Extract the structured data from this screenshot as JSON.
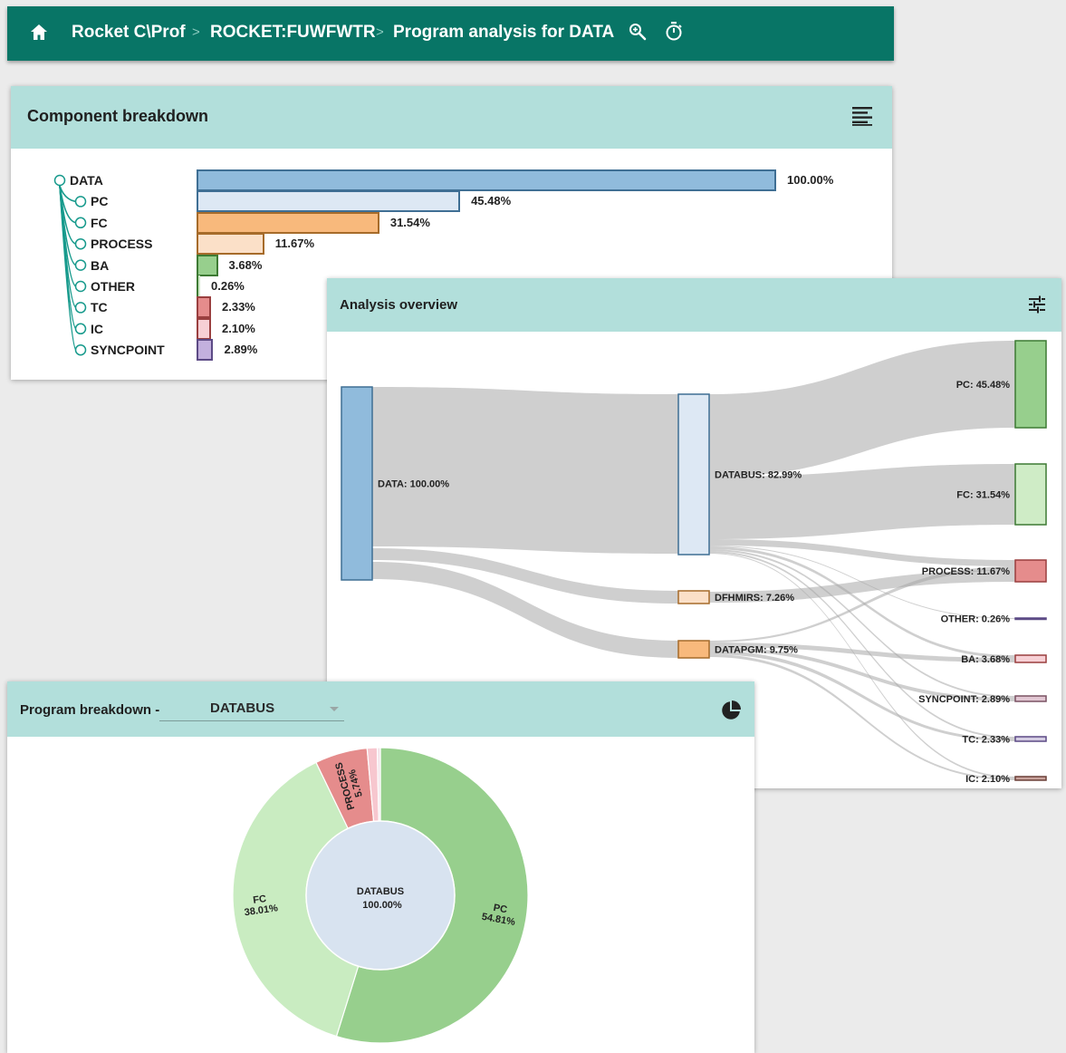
{
  "breadcrumb": {
    "items": [
      "Rocket C\\Prof",
      "ROCKET:FUWFWTR",
      "Program analysis for DATA"
    ],
    "separator": ">"
  },
  "icons": {
    "home": "home-icon",
    "search": "search-zoom-icon",
    "timer": "stopwatch-icon",
    "list": "align-list-icon",
    "tune": "tune-sliders-icon",
    "pie": "pie-chart-icon"
  },
  "colors": {
    "topbar": "#087566",
    "panel_header": "#b2dfdb",
    "tree_line": "#179a8c"
  },
  "component_breakdown": {
    "title": "Component breakdown",
    "rows": [
      {
        "name": "DATA",
        "value": "100.00%",
        "pct": 100.0,
        "fill": "#90bbdc",
        "stroke": "#3f6f94",
        "level": 0
      },
      {
        "name": "PC",
        "value": "45.48%",
        "pct": 45.48,
        "fill": "#dde8f4",
        "stroke": "#3f6f94",
        "level": 1
      },
      {
        "name": "FC",
        "value": "31.54%",
        "pct": 31.54,
        "fill": "#f8b97c",
        "stroke": "#a66b2a",
        "level": 1
      },
      {
        "name": "PROCESS",
        "value": "11.67%",
        "pct": 11.67,
        "fill": "#fbe0c8",
        "stroke": "#a66b2a",
        "level": 1
      },
      {
        "name": "BA",
        "value": "3.68%",
        "pct": 3.68,
        "fill": "#97cf8d",
        "stroke": "#3d7a33",
        "level": 1
      },
      {
        "name": "OTHER",
        "value": "0.26%",
        "pct": 0.26,
        "fill": "#cfe9c7",
        "stroke": "#3d7a33",
        "level": 1
      },
      {
        "name": "TC",
        "value": "2.33%",
        "pct": 2.33,
        "fill": "#e58c8c",
        "stroke": "#9a3f3f",
        "level": 1
      },
      {
        "name": "IC",
        "value": "2.10%",
        "pct": 2.1,
        "fill": "#f7d0d5",
        "stroke": "#9a3f3f",
        "level": 1
      },
      {
        "name": "SYNCPOINT",
        "value": "2.89%",
        "pct": 2.89,
        "fill": "#c3b0de",
        "stroke": "#5c4a85",
        "level": 1
      }
    ]
  },
  "analysis_overview": {
    "title": "Analysis overview",
    "nodes": [
      {
        "id": "data",
        "label": "DATA: 100.00%",
        "pct": 100.0,
        "column": 0,
        "fill": "#90bbdc",
        "stroke": "#3f6f94"
      },
      {
        "id": "databus",
        "label": "DATABUS: 82.99%",
        "pct": 82.99,
        "column": 1,
        "fill": "#dde8f4",
        "stroke": "#3f6f94"
      },
      {
        "id": "dfhmirs",
        "label": "DFHMIRS: 7.26%",
        "pct": 7.26,
        "column": 1,
        "fill": "#fbe0c8",
        "stroke": "#a66b2a"
      },
      {
        "id": "datapgm",
        "label": "DATAPGM: 9.75%",
        "pct": 9.75,
        "column": 1,
        "fill": "#f8b97c",
        "stroke": "#a66b2a"
      },
      {
        "id": "pc",
        "label": "PC: 45.48%",
        "pct": 45.48,
        "column": 2,
        "fill": "#97cf8d",
        "stroke": "#3d7a33"
      },
      {
        "id": "fc",
        "label": "FC: 31.54%",
        "pct": 31.54,
        "column": 2,
        "fill": "#cfecc6",
        "stroke": "#3d7a33"
      },
      {
        "id": "process",
        "label": "PROCESS: 11.67%",
        "pct": 11.67,
        "column": 2,
        "fill": "#e58c8c",
        "stroke": "#9a3f3f"
      },
      {
        "id": "other",
        "label": "OTHER: 0.26%",
        "pct": 0.26,
        "column": 2,
        "fill": "#c3b0de",
        "stroke": "#5c4a85"
      },
      {
        "id": "ba",
        "label": "BA: 3.68%",
        "pct": 3.68,
        "column": 2,
        "fill": "#f7d0d5",
        "stroke": "#9a3f3f"
      },
      {
        "id": "syncpoint",
        "label": "SYNCPOINT: 2.89%",
        "pct": 2.89,
        "column": 2,
        "fill": "#e2c7d3",
        "stroke": "#7a5263"
      },
      {
        "id": "tc",
        "label": "TC: 2.33%",
        "pct": 2.33,
        "column": 2,
        "fill": "#d5cde3",
        "stroke": "#5c4a85"
      },
      {
        "id": "ic",
        "label": "IC: 2.10%",
        "pct": 2.1,
        "column": 2,
        "fill": "#c9a39c",
        "stroke": "#6b4038"
      }
    ]
  },
  "program_breakdown": {
    "title": "Program breakdown -",
    "selected": "DATABUS",
    "center_name": "DATABUS",
    "center_value": "100.00%",
    "slices": [
      {
        "name": "PC",
        "value": "54.81%",
        "pct": 54.81,
        "fill": "#97cf8d",
        "labeled": true
      },
      {
        "name": "FC",
        "value": "38.01%",
        "pct": 38.01,
        "fill": "#c9ecc1",
        "labeled": true
      },
      {
        "name": "PROCESS",
        "value": "5.74%",
        "pct": 5.74,
        "fill": "#e58c8c",
        "labeled": true
      },
      {
        "name": "",
        "value": "",
        "pct": 1.1,
        "fill": "#f7c7cf",
        "labeled": false
      },
      {
        "name": "",
        "value": "",
        "pct": 0.34,
        "fill": "#f3e4ea",
        "labeled": false
      }
    ]
  }
}
